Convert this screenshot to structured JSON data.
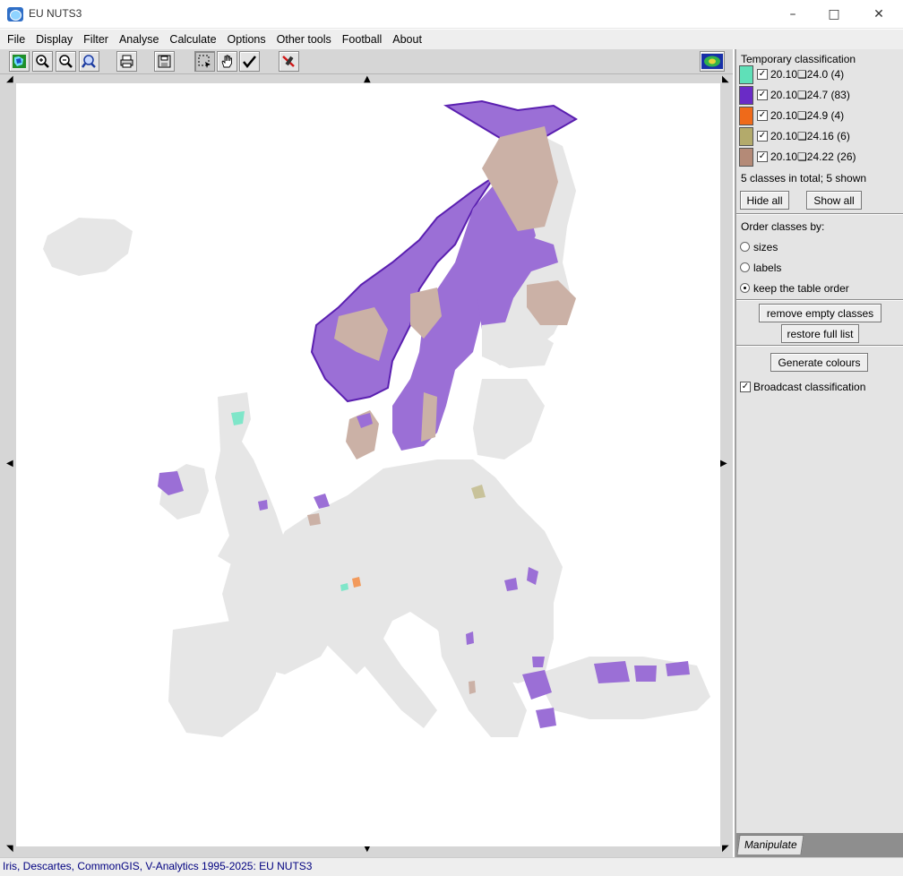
{
  "window": {
    "title": "EU NUTS3",
    "minimize_glyph": "–",
    "maximize_glyph": "□",
    "close_glyph": "✕"
  },
  "menu": [
    "File",
    "Display",
    "Filter",
    "Analyse",
    "Calculate",
    "Options",
    "Other tools",
    "Football",
    "About"
  ],
  "toolbar": {
    "buttons": [
      "map-icon",
      "zoom-in-icon",
      "zoom-out-icon",
      "pan-zoom-icon",
      "print-icon",
      "save-icon",
      "select-rectangle-icon",
      "hand-icon",
      "checkmark-icon",
      "erase-icon",
      "overview-icon"
    ]
  },
  "panel": {
    "title": "Temporary classification",
    "classes": [
      {
        "label": "20.10❏24.0 (4)",
        "color": "#5fe0b8",
        "checked": true
      },
      {
        "label": "20.10❏24.7 (83)",
        "color": "#6a2bc6",
        "checked": true
      },
      {
        "label": "20.10❏24.9 (4)",
        "color": "#ef6a1a",
        "checked": true
      },
      {
        "label": "20.10❏24.16 (6)",
        "color": "#b3aa6b",
        "checked": true
      },
      {
        "label": "20.10❏24.22 (26)",
        "color": "#b48a77",
        "checked": true
      }
    ],
    "summary": "5 classes in total; 5 shown",
    "hide_all": "Hide all",
    "show_all": "Show all",
    "order_label": "Order classes by:",
    "order_options": [
      "sizes",
      "labels",
      "keep the table order"
    ],
    "order_selected": "keep the table order",
    "remove_empty": "remove empty classes",
    "restore_list": "restore full list",
    "generate_colours": "Generate colours",
    "broadcast_label": "Broadcast classification",
    "broadcast_checked": true,
    "tab": "Manipulate"
  },
  "map": {
    "colors": {
      "base": "#e6e6e6",
      "purple": "#9b6fd6",
      "purple_edge": "#5a1fb0",
      "tan": "#cbb1a6",
      "teal": "#7fe6c9",
      "orange": "#f29a5c",
      "olive": "#c8c29a"
    }
  },
  "status": "Iris, Descartes, CommonGIS, V-Analytics 1995-2025: EU NUTS3"
}
